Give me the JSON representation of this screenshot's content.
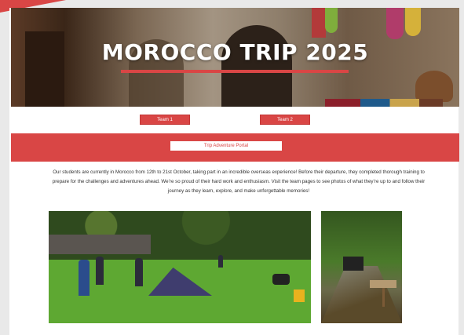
{
  "hero": {
    "title": "MOROCCO TRIP 2025"
  },
  "teams": [
    {
      "label": "Team 1"
    },
    {
      "label": "Team 2"
    }
  ],
  "portal": {
    "label": "Trip Adventure Portal"
  },
  "intro": {
    "text": "Our students are currently in Morocco from 12th to 21st October, taking part in an incredible overseas experience! Before their departure, they completed thorough training to prepare for the challenges and adventures ahead. We’re so proud of their hard work and enthusiasm. Visit the team pages to see photos of what they’re up to and follow their journey as they learn, explore, and make unforgettable memories!"
  },
  "colors": {
    "accent": "#d94645",
    "background": "#ffffff"
  }
}
